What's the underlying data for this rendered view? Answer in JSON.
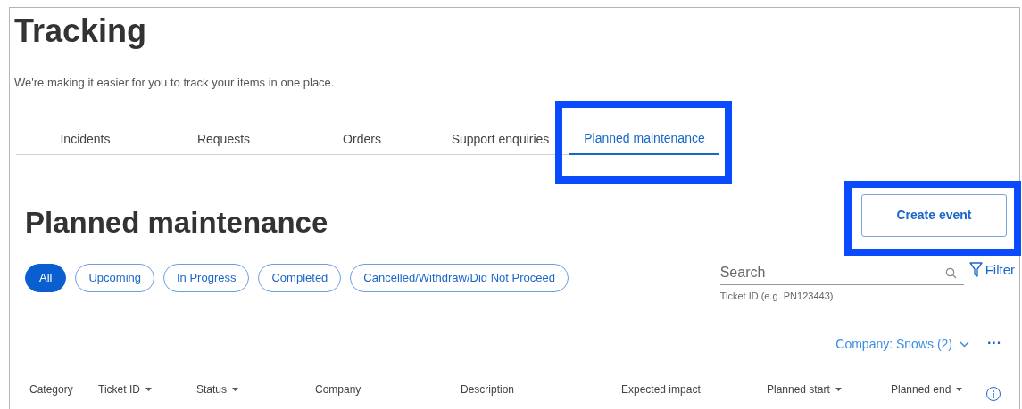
{
  "page": {
    "title": "Tracking",
    "subtitle": "We're making it easier for you to track your items in one place."
  },
  "tabs": [
    {
      "label": "Incidents",
      "selected": false,
      "highlighted": false
    },
    {
      "label": "Requests",
      "selected": false,
      "highlighted": false
    },
    {
      "label": "Orders",
      "selected": false,
      "highlighted": false
    },
    {
      "label": "Support enquiries",
      "selected": false,
      "highlighted": false
    },
    {
      "label": "Planned maintenance",
      "selected": true,
      "highlighted": true
    }
  ],
  "section": {
    "title": "Planned maintenance",
    "create_button": {
      "label": "Create event",
      "highlighted": true
    }
  },
  "status_filters": [
    {
      "label": "All",
      "selected": true
    },
    {
      "label": "Upcoming",
      "selected": false
    },
    {
      "label": "In Progress",
      "selected": false
    },
    {
      "label": "Completed",
      "selected": false
    },
    {
      "label": "Cancelled/Withdraw/Did Not Proceed",
      "selected": false
    }
  ],
  "search": {
    "placeholder": "Search",
    "helper": "Ticket ID (e.g. PN123443)"
  },
  "filter_button": "Filter",
  "company_filter": "Company: Snows (2)",
  "more_button": "···",
  "table": {
    "columns": [
      {
        "label": "Category",
        "sortable": false
      },
      {
        "label": "Ticket ID",
        "sortable": true
      },
      {
        "label": "Status",
        "sortable": true
      },
      {
        "label": "Company",
        "sortable": false
      },
      {
        "label": "Description",
        "sortable": false
      },
      {
        "label": "Expected impact",
        "sortable": false
      },
      {
        "label": "Planned start",
        "sortable": true
      },
      {
        "label": "Planned end",
        "sortable": true
      }
    ]
  }
}
